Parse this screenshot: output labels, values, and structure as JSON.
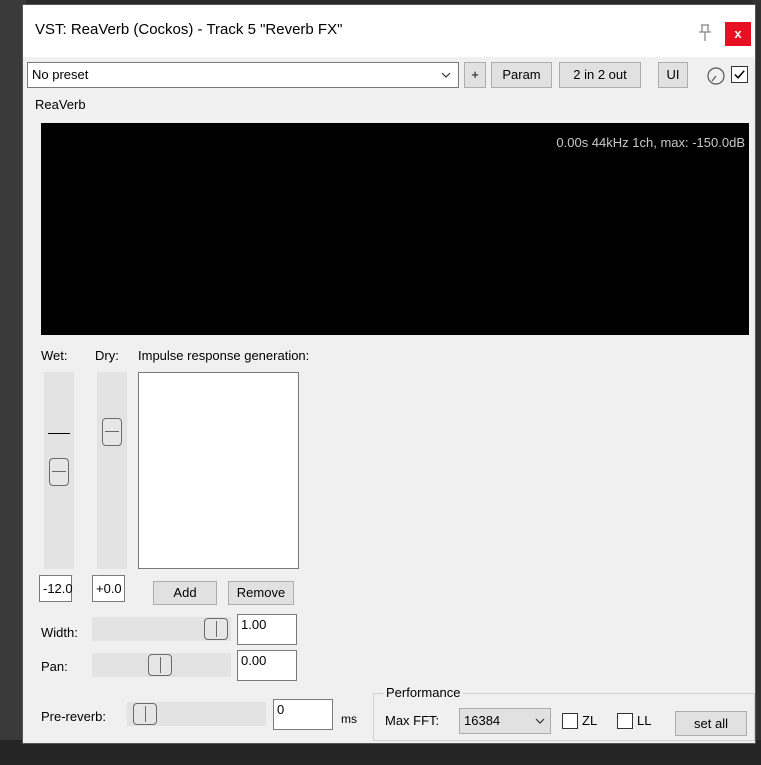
{
  "window": {
    "title": "VST: ReaVerb (Cockos) - Track 5 \"Reverb FX\"",
    "close_label": "x"
  },
  "toolbar": {
    "preset_value": "No preset",
    "add_label": "+",
    "param_label": "Param",
    "io_label": "2 in 2 out",
    "ui_label": "UI",
    "bypass_checked": true
  },
  "plugin": {
    "group_label": "ReaVerb",
    "display_info": "0.00s 44kHz 1ch, max: -150.0dB"
  },
  "mix": {
    "wet_label": "Wet:",
    "dry_label": "Dry:",
    "wet_value": "-12.0",
    "dry_value": "+0.0"
  },
  "ir": {
    "label": "Impulse response generation:",
    "add_label": "Add",
    "remove_label": "Remove",
    "items": []
  },
  "width": {
    "label": "Width:",
    "value": "1.00"
  },
  "pan": {
    "label": "Pan:",
    "value": "0.00"
  },
  "pre_reverb": {
    "label": "Pre-reverb:",
    "value": "0",
    "unit": "ms"
  },
  "performance": {
    "group_label": "Performance",
    "max_fft_label": "Max FFT:",
    "max_fft_value": "16384",
    "zl_label": "ZL",
    "ll_label": "LL",
    "set_all_label": "set all"
  },
  "colors": {
    "close_button": "#e81123",
    "display_background": "#000000",
    "display_text": "#c8c8c8",
    "window_background": "#f0f0f0"
  }
}
